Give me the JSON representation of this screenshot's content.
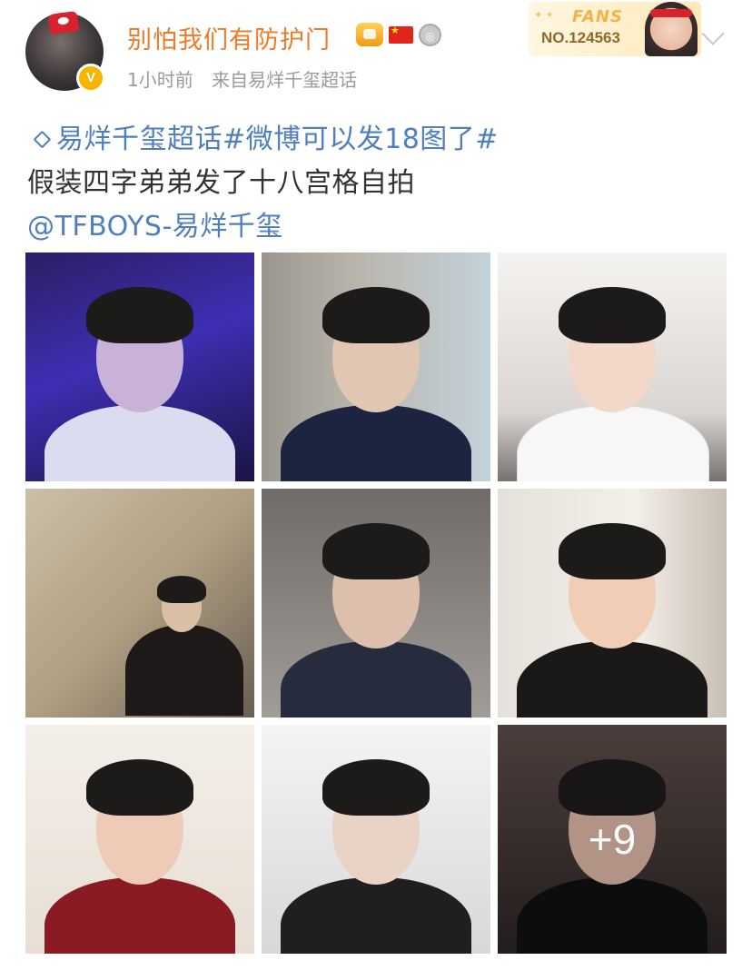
{
  "header": {
    "username": "别怕我们有防护门",
    "time": "1小时前",
    "source": "来自易烊千玺超话",
    "verified_mark": "V",
    "fans_card": {
      "title": "FANS",
      "number": "NO.124563"
    }
  },
  "post": {
    "topic_line": "易烊千玺超话#微博可以发18图了#",
    "text_line": "假装四字弟弟发了十八宫格自拍",
    "mention_line": "@TFBOYS-易烊千玺",
    "more_count_label": "+9"
  },
  "colors": {
    "username": "#f07a25",
    "link": "#4f7fbf",
    "meta": "#9a9a9a",
    "body_text": "#333333"
  },
  "icons": [
    "diamond-icon",
    "chevron-down-icon",
    "crown-badge-icon",
    "flag-icon",
    "medal-icon",
    "verified-icon"
  ]
}
